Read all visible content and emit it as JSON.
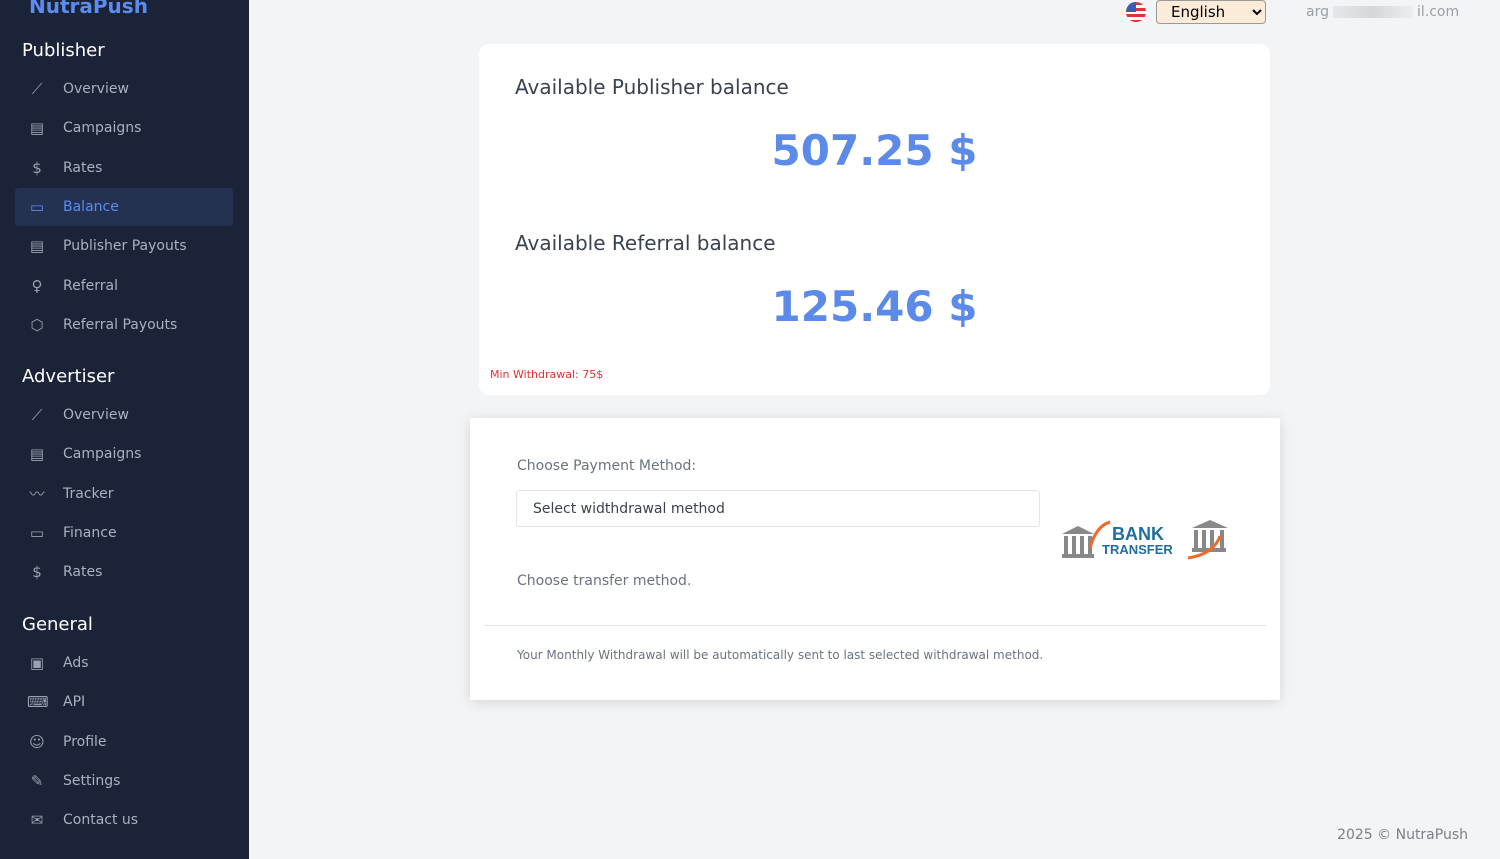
{
  "sidebar": {
    "logo": "NutraPush",
    "sections": [
      {
        "title": "Publisher",
        "items": [
          {
            "label": "Overview",
            "icon": "chart-line-icon"
          },
          {
            "label": "Campaigns",
            "icon": "book-icon"
          },
          {
            "label": "Rates",
            "icon": "dollar-icon"
          },
          {
            "label": "Balance",
            "icon": "wallet-icon",
            "active": true
          },
          {
            "label": "Publisher Payouts",
            "icon": "receipt-icon"
          },
          {
            "label": "Referral",
            "icon": "award-icon"
          },
          {
            "label": "Referral Payouts",
            "icon": "badge-icon"
          }
        ]
      },
      {
        "title": "Advertiser",
        "items": [
          {
            "label": "Overview",
            "icon": "chart-line-icon"
          },
          {
            "label": "Campaigns",
            "icon": "book-icon"
          },
          {
            "label": "Tracker",
            "icon": "activity-icon"
          },
          {
            "label": "Finance",
            "icon": "wallet-icon"
          },
          {
            "label": "Rates",
            "icon": "dollar-icon"
          }
        ]
      },
      {
        "title": "General",
        "items": [
          {
            "label": "Ads",
            "icon": "image-icon"
          },
          {
            "label": "API",
            "icon": "code-icon"
          },
          {
            "label": "Profile",
            "icon": "user-icon"
          },
          {
            "label": "Settings",
            "icon": "edit-icon"
          },
          {
            "label": "Contact us",
            "icon": "mail-icon"
          }
        ]
      }
    ]
  },
  "topbar": {
    "language": "English",
    "email_start": "arg",
    "email_end": "il.com"
  },
  "balance": {
    "publisher_label": "Available Publisher balance",
    "publisher_amount": "507.25 $",
    "referral_label": "Available Referral balance",
    "referral_amount": "125.46 $",
    "min_withdrawal": "Min Withdrawal: 75$"
  },
  "payment": {
    "label": "Choose Payment Method:",
    "select_placeholder": "Select widthdrawal method",
    "transfer_hint": "Choose transfer method.",
    "note": "Your Monthly Withdrawal will be automatically sent to last selected withdrawal method.",
    "bank_logo": "BANK TRANSFER"
  },
  "footer": "2025 © NutraPush"
}
